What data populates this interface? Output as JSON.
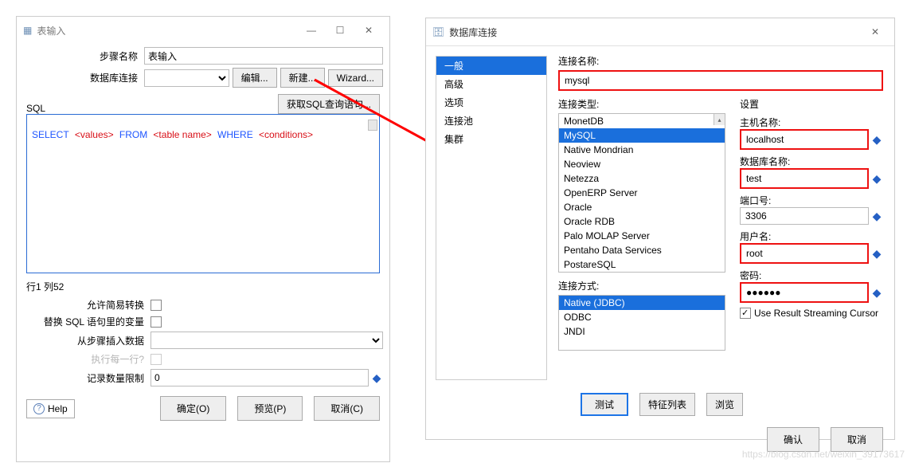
{
  "left": {
    "title": "表输入",
    "step_name_label": "步骤名称",
    "step_name_value": "表输入",
    "db_conn_label": "数据库连接",
    "db_conn_value": "",
    "btn_edit": "编辑...",
    "btn_new": "新建...",
    "btn_wizard": "Wizard...",
    "sql_label": "SQL",
    "btn_get_sql": "获取SQL查询语句...",
    "sql_kw1": "SELECT",
    "sql_v1": "<values>",
    "sql_kw2": "FROM",
    "sql_v2": "<table name>",
    "sql_kw3": "WHERE",
    "sql_v3": "<conditions>",
    "status_line": "行1 列52",
    "chk_allow_simple": "允许简易转换",
    "chk_replace_var": "替换 SQL 语句里的变量",
    "lbl_from_step": "从步骤插入数据",
    "lbl_exec_each": "执行每一行?",
    "lbl_limit": "记录数量限制",
    "limit_value": "0",
    "btn_help": "Help",
    "btn_ok": "确定(O)",
    "btn_preview": "预览(P)",
    "btn_cancel": "取消(C)"
  },
  "right": {
    "title": "数据库连接",
    "side": {
      "i0": "一般",
      "i1": "高级",
      "i2": "选项",
      "i3": "连接池",
      "i4": "集群"
    },
    "lbl_conn_name": "连接名称:",
    "conn_name": "mysql",
    "lbl_conn_type": "连接类型:",
    "types": {
      "t0": "MonetDB",
      "t1": "MySQL",
      "t2": "Native Mondrian",
      "t3": "Neoview",
      "t4": "Netezza",
      "t5": "OpenERP Server",
      "t6": "Oracle",
      "t7": "Oracle RDB",
      "t8": "Palo MOLAP Server",
      "t9": "Pentaho Data Services",
      "t10": "PostareSQL"
    },
    "lbl_access": "连接方式:",
    "access": {
      "a0": "Native (JDBC)",
      "a1": "ODBC",
      "a2": "JNDI"
    },
    "lbl_settings": "设置",
    "lbl_host": "主机名称:",
    "host": "localhost",
    "lbl_dbname": "数据库名称:",
    "dbname": "test",
    "lbl_port": "端口号:",
    "port": "3306",
    "lbl_user": "用户名:",
    "user": "root",
    "lbl_pass": "密码:",
    "pass": "●●●●●●",
    "chk_cursor": "Use Result Streaming Cursor",
    "btn_test": "测试",
    "btn_features": "特征列表",
    "btn_browse": "浏览",
    "btn_confirm": "确认",
    "btn_cancel": "取消"
  },
  "watermark": "https://blog.csdn.net/weixin_39173617"
}
